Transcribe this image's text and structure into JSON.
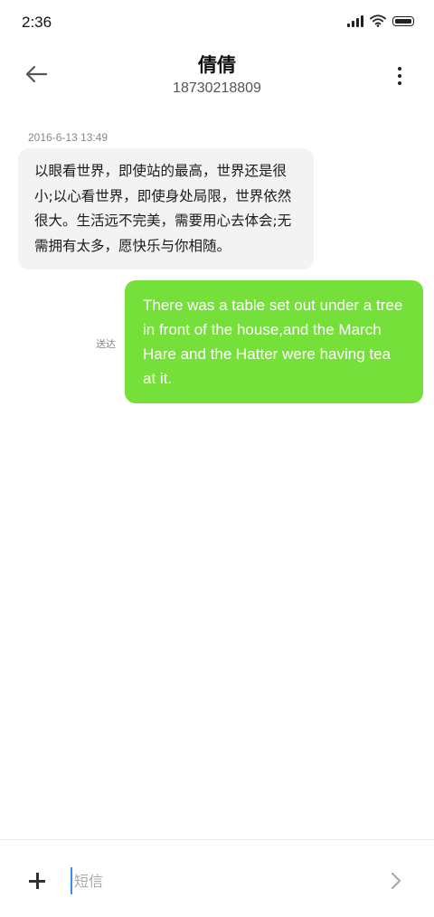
{
  "status_bar": {
    "time": "2:36",
    "icons": [
      "signal-icon",
      "wifi-icon",
      "battery-icon"
    ]
  },
  "header": {
    "back_icon": "arrow-left-icon",
    "contact_name": "倩倩",
    "contact_number": "18730218809",
    "more_icon": "more-vertical-icon"
  },
  "conversation": {
    "timestamp": "2016-6-13 13:49",
    "incoming_message": "以眼看世界，即使站的最高，世界还是很小;以心看世界，即使身处局限，世界依然很大。生活远不完美，需要用心去体会;无需拥有太多，愿快乐与你相随。",
    "outgoing_message": "There was a table set out under a tree in front of the house,and the March Hare and the Hatter were having tea at it.",
    "outgoing_status": "送达"
  },
  "composer": {
    "attach_icon": "plus-icon",
    "placeholder": "短信",
    "value": "",
    "send_icon": "chevron-right-icon"
  },
  "colors": {
    "outgoing_bubble": "#76e03a",
    "incoming_bubble": "#f3f3f3",
    "cursor": "#3a8ef0"
  }
}
